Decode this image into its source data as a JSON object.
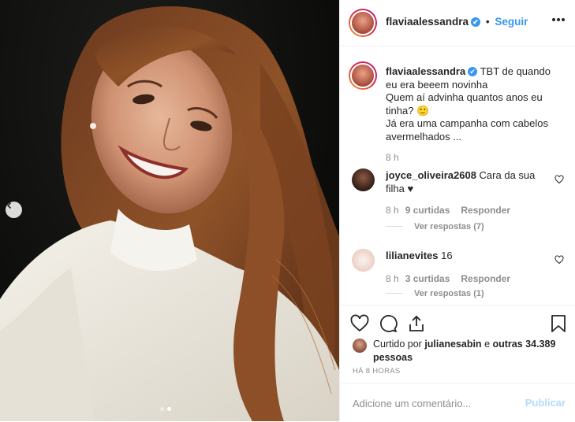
{
  "post": {
    "username": "flaviaalessandra",
    "separator": "•",
    "follow_label": "Seguir",
    "more_icon": "more-horizontal-icon",
    "verified_icon": "verified-badge-icon",
    "verified_glyph": "✔",
    "carousel": {
      "total": 2,
      "active_index": 2
    }
  },
  "caption": {
    "username": "flaviaalessandra",
    "line1": "TBT de quando eu era beeem novinha",
    "line2": "Quem aí advinha quantos anos eu tinha? 🙂",
    "line3": "Já era uma campanha com cabelos avermelhados ...",
    "time": "8 h"
  },
  "comments": [
    {
      "username": "joyce_oliveira2608",
      "text": "Cara da sua filha ♥",
      "time": "8 h",
      "likes": "9 curtidas",
      "reply_label": "Responder",
      "view_replies": "Ver respostas (7)"
    },
    {
      "username": "lilianevites",
      "text": "16",
      "time": "8 h",
      "likes": "3 curtidas",
      "reply_label": "Responder",
      "view_replies": "Ver respostas (1)"
    }
  ],
  "actions": {
    "icons": [
      "heart-icon",
      "comment-icon",
      "share-icon",
      "bookmark-icon"
    ],
    "liked_prefix": "Curtido por",
    "liked_user": "julianesabin",
    "liked_and": "e",
    "liked_others": "outras 34.389 pessoas",
    "time_ago": "HÁ 8 HORAS"
  },
  "comment_input": {
    "placeholder": "Adicione um comentário...",
    "submit_label": "Publicar"
  },
  "colors": {
    "accent_blue": "#3897f0",
    "publish_disabled": "#b3dbff",
    "muted_text": "#8e8e8e",
    "border": "#efefef"
  }
}
